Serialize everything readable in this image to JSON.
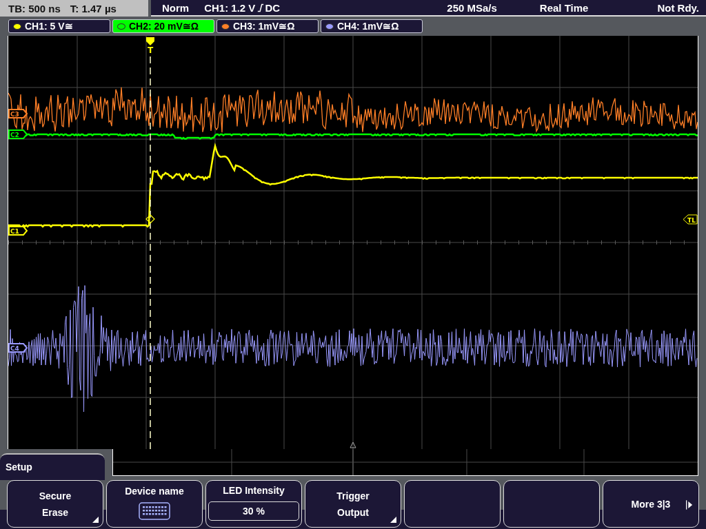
{
  "status_bar": {
    "timebase": "TB: 500 ns",
    "trigger_time": "T: 1.47 µs",
    "trigger_mode": "Norm",
    "trigger_source": "CH1: 1.2 V",
    "trigger_coupling": "DC",
    "sample_rate": "250 MSa/s",
    "acquisition_mode": "Real Time",
    "trigger_status": "Not Rdy."
  },
  "channels": [
    {
      "label": "CH1: 5 V≅",
      "color": "#ffff00",
      "selected": false
    },
    {
      "label": "CH2: 20 mV≅Ω",
      "color": "#00ff00",
      "selected": true
    },
    {
      "label": "CH3: 1mV≅Ω",
      "color": "#ff7f27",
      "selected": false
    },
    {
      "label": "CH4: 1mV≅Ω",
      "color": "#9a9aff",
      "selected": false
    }
  ],
  "trace_markers": [
    {
      "label": "C3",
      "color": "#ff7f27"
    },
    {
      "label": "C2",
      "color": "#00ff00"
    },
    {
      "label": "C1",
      "color": "#ffff00"
    },
    {
      "label": "C4",
      "color": "#9a9aff"
    }
  ],
  "trigger_marker": "T",
  "trigger_level_marker": "TL",
  "menu": {
    "title": "Setup",
    "softkeys": [
      {
        "kind": "submenu",
        "lines": [
          "Secure",
          "Erase"
        ]
      },
      {
        "kind": "keyboard",
        "lines": [
          "Device name"
        ]
      },
      {
        "kind": "value",
        "lines": [
          "LED Intensity"
        ],
        "value": "30 %"
      },
      {
        "kind": "submenu",
        "lines": [
          "Trigger",
          "Output"
        ]
      },
      {
        "kind": "empty"
      },
      {
        "kind": "empty"
      },
      {
        "kind": "next",
        "lines": [
          "More 3|3"
        ]
      }
    ]
  }
}
